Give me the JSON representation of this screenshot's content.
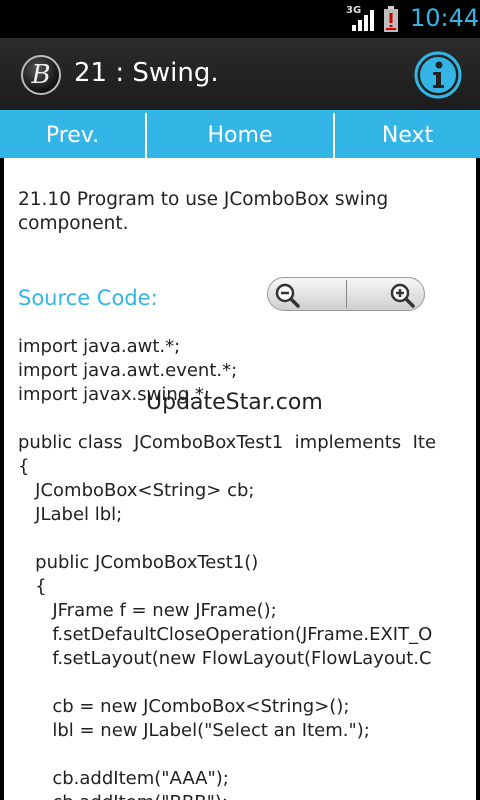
{
  "status_bar": {
    "network": "3G",
    "time": "10:44"
  },
  "header": {
    "logo_letter": "B",
    "title": "21 : Swing."
  },
  "nav": {
    "prev": "Prev.",
    "home": "Home",
    "next": "Next"
  },
  "content": {
    "heading": "21.10 Program to use JComboBox swing component.",
    "source_label": "Source Code:",
    "code_lines": [
      "import java.awt.*;",
      "import java.awt.event.*;",
      "import javax.swing.*;",
      "",
      "public class  JComboBoxTest1  implements  Ite",
      "{",
      "   JComboBox<String> cb;",
      "   JLabel lbl;",
      "",
      "   public JComboBoxTest1()",
      "   {",
      "      JFrame f = new JFrame();",
      "      f.setDefaultCloseOperation(JFrame.EXIT_O",
      "      f.setLayout(new FlowLayout(FlowLayout.C",
      "",
      "      cb = new JComboBox<String>();",
      "      lbl = new JLabel(\"Select an Item.\");",
      "",
      "      cb.addItem(\"AAA\");",
      "      cb.addItem(\"BBB\");"
    ],
    "watermark": "UpdateStar.com"
  },
  "colors": {
    "accent": "#33b5e5",
    "actionbar": "#222222",
    "content_bg": "#ffffff"
  },
  "icons": {
    "info": "info-icon",
    "zoom_in": "zoom-in-icon",
    "zoom_out": "zoom-out-icon"
  }
}
